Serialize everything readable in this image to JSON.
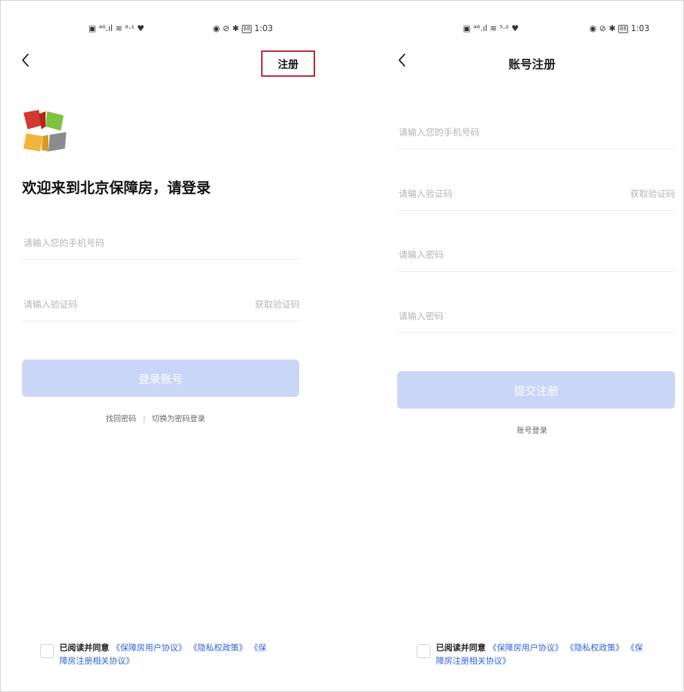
{
  "login": {
    "status": {
      "left": "▣ ⁴⁶.ıl ≋ ⁶·¹ ♥",
      "right": "◉ ⊘ ✱",
      "battery": "88",
      "time": "1:03"
    },
    "register_link": "注册",
    "welcome": "欢迎来到北京保障房，请登录",
    "phone_placeholder": "请输入您的手机号码",
    "code_placeholder": "请输入验证码",
    "get_code": "获取验证码",
    "submit": "登录账号",
    "recover_password": "找回密码",
    "separator": "|",
    "switch_password_login": "切换为密码登录",
    "agree_prefix": "已阅读并同意",
    "agree_link_1": "《保障房用户协议》",
    "agree_link_2": "《隐私权政策》",
    "agree_link_3": "《保障房注册相关协议》"
  },
  "register": {
    "status": {
      "left": "▣ ⁴⁶.ıl ≋ ⁵·² ♥",
      "right": "◉ ⊘ ✱",
      "battery": "88",
      "time": "1:03"
    },
    "title": "账号注册",
    "phone_placeholder": "请输入您的手机号码",
    "code_placeholder": "请输入验证码",
    "get_code": "获取验证码",
    "password_placeholder": "请输入密码",
    "password_confirm_placeholder": "请输入密码",
    "submit": "提交注册",
    "account_login": "账号登录",
    "agree_prefix": "已阅读并同意",
    "agree_link_1": "《保障房用户协议》",
    "agree_link_2": "《隐私权政策》",
    "agree_link_3": "《保障房注册相关协议》"
  },
  "colors": {
    "button_disabled": "#c9d6f7",
    "highlight_box": "#b81d2a",
    "link": "#2f64d8",
    "logo": [
      "#d23a30",
      "#7cc342",
      "#f2b43a",
      "#8c8c8c"
    ]
  }
}
